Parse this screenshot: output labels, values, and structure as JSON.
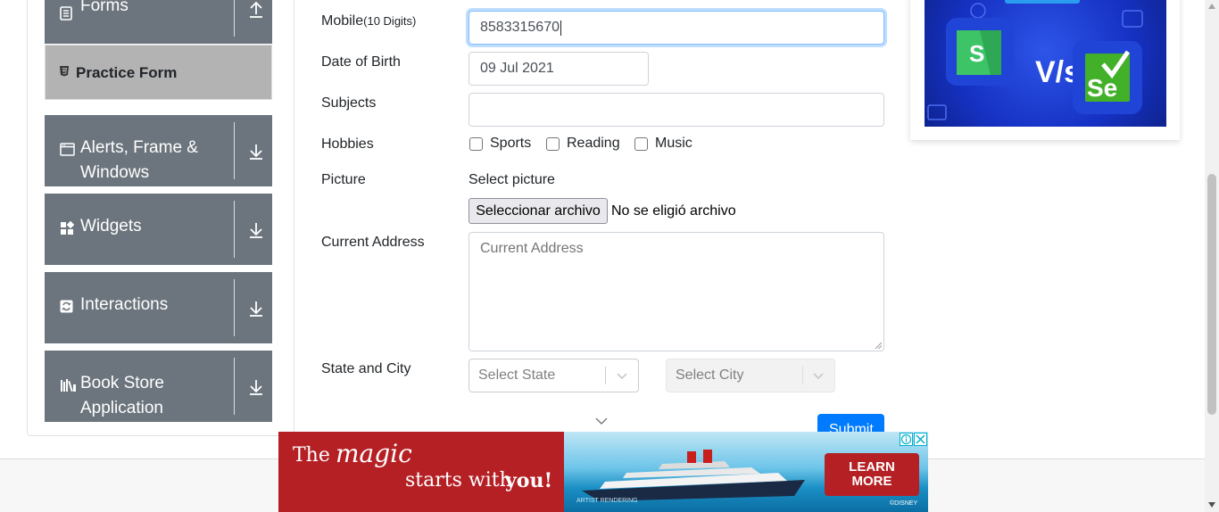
{
  "sidebar": {
    "forms_label": "Forms",
    "practice_form_label": "Practice Form",
    "alerts_line1": "Alerts, Frame &",
    "alerts_line2": "Windows",
    "widgets_label": "Widgets",
    "interactions_label": "Interactions",
    "bookstore_line1": "Book Store",
    "bookstore_line2": "Application"
  },
  "form": {
    "mobile_label": "Mobile",
    "mobile_hint": "(10 Digits)",
    "mobile_value": "8583315670",
    "dob_label": "Date of Birth",
    "dob_value": "09 Jul 2021",
    "subjects_label": "Subjects",
    "hobbies_label": "Hobbies",
    "hobbies": [
      "Sports",
      "Reading",
      "Music"
    ],
    "picture_label": "Picture",
    "picture_prompt": "Select picture",
    "file_button": "Seleccionar archivo",
    "file_status": "No se eligió archivo",
    "address_label": "Current Address",
    "address_placeholder": "Current Address",
    "state_city_label": "State and City",
    "state_placeholder": "Select State",
    "city_placeholder": "Select City",
    "submit_label": "Submit"
  },
  "bottom_ad": {
    "line1_a": "The",
    "line1_b": "magic",
    "line2_a": "starts with",
    "line2_b": "you!",
    "cta_line1": "LEARN",
    "cta_line2": "MORE",
    "small_text": "ARTIST RENDERING",
    "brand": "©DISNEY"
  },
  "colors": {
    "sidebar_group": "#6c757d",
    "active_item": "#b3b3b3",
    "primary": "#007bff",
    "ad_red": "#b52025"
  }
}
